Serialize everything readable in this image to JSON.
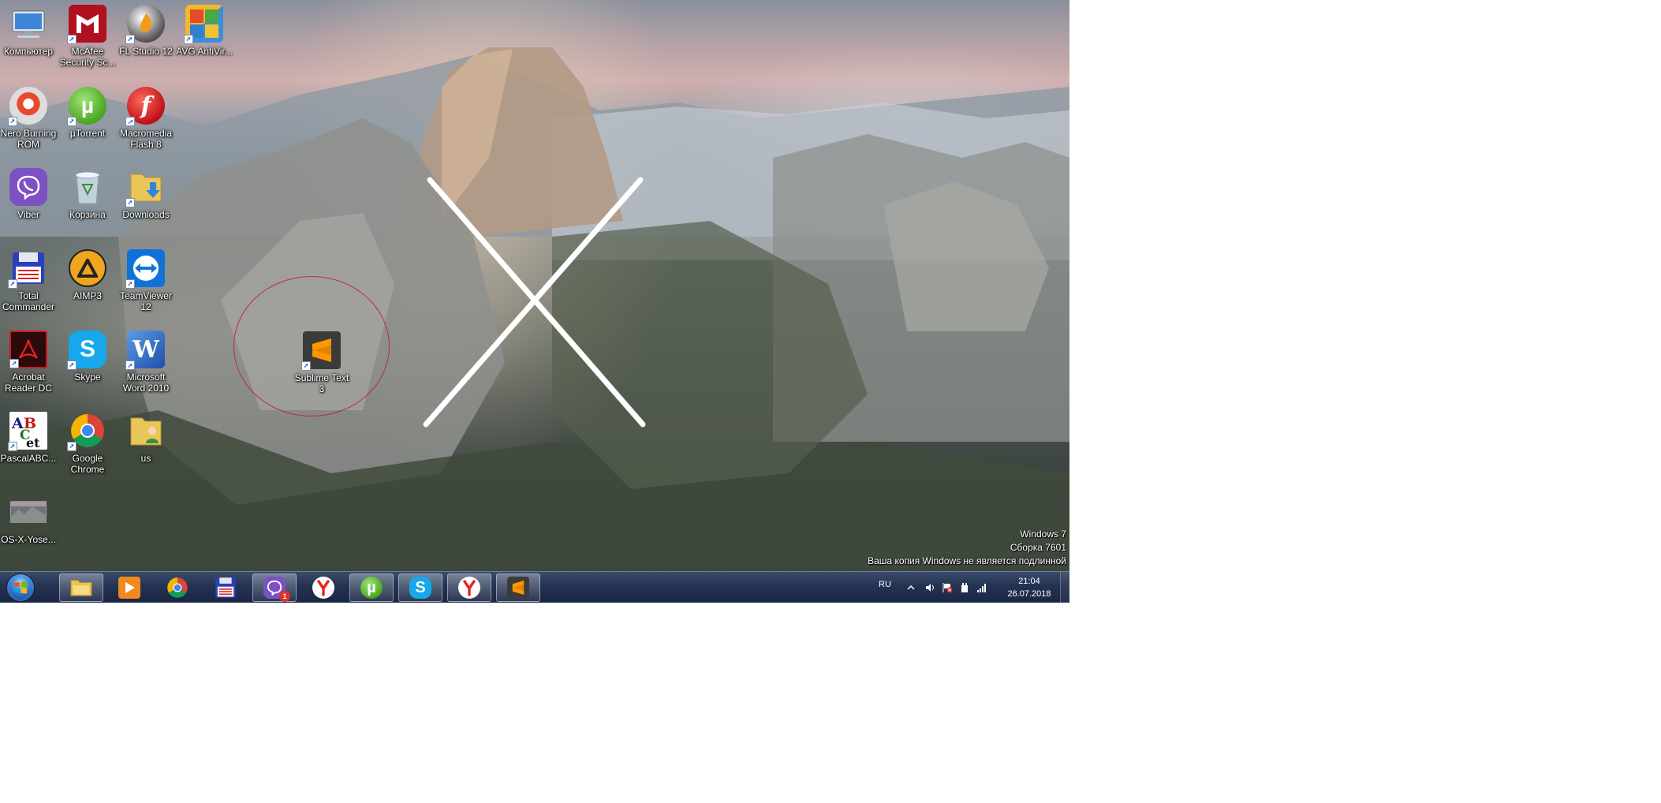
{
  "desktop": {
    "icons": [
      {
        "label": "Компьютер",
        "icon": "computer-icon"
      },
      {
        "label": "McAfee Security Sc...",
        "icon": "mcafee-icon"
      },
      {
        "label": "FL Studio 12",
        "icon": "fl-studio-icon"
      },
      {
        "label": "AVG AntiVir...",
        "icon": "avg-icon"
      },
      {
        "label": "Nero Burning ROM",
        "icon": "nero-icon"
      },
      {
        "label": "µTorrent",
        "icon": "utorrent-icon"
      },
      {
        "label": "Macromedia Flash 8",
        "icon": "flash-icon"
      },
      {
        "label": "Viber",
        "icon": "viber-icon"
      },
      {
        "label": "Корзина",
        "icon": "recycle-bin-icon"
      },
      {
        "label": "Downloads",
        "icon": "downloads-folder-icon"
      },
      {
        "label": "Total Commander",
        "icon": "total-commander-icon"
      },
      {
        "label": "AIMP3",
        "icon": "aimp-icon"
      },
      {
        "label": "TeamViewer 12",
        "icon": "teamviewer-icon"
      },
      {
        "label": "Acrobat Reader DC",
        "icon": "acrobat-icon"
      },
      {
        "label": "Skype",
        "icon": "skype-icon"
      },
      {
        "label": "Microsoft Word 2010",
        "icon": "word-icon"
      },
      {
        "label": "PascalABC...",
        "icon": "pascalabc-icon"
      },
      {
        "label": "Google Chrome",
        "icon": "chrome-icon"
      },
      {
        "label": "us",
        "icon": "user-folder-icon"
      },
      {
        "label": "OS-X-Yose...",
        "icon": "image-file-icon"
      },
      {
        "label": "Sublime Text 3",
        "icon": "sublime-text-icon"
      }
    ],
    "watermark": {
      "line1": "Windows 7",
      "line2": "Сборка 7601",
      "line3": "Ваша копия Windows не является подлинной"
    }
  },
  "taskbar": {
    "pinned": [
      {
        "name": "explorer",
        "icon": "explorer-folder-icon"
      },
      {
        "name": "media-player",
        "icon": "media-player-icon"
      },
      {
        "name": "chrome",
        "icon": "chrome-icon"
      },
      {
        "name": "total-commander",
        "icon": "total-commander-icon"
      },
      {
        "name": "viber",
        "icon": "viber-icon",
        "badge": "1"
      },
      {
        "name": "yandex",
        "icon": "yandex-browser-icon"
      },
      {
        "name": "utorrent",
        "icon": "utorrent-icon"
      },
      {
        "name": "skype",
        "icon": "skype-icon"
      },
      {
        "name": "yandex-2",
        "icon": "yandex-browser-icon"
      },
      {
        "name": "sublime-text",
        "icon": "sublime-text-icon"
      }
    ],
    "tray": {
      "language": "RU",
      "time": "21:04",
      "date": "26.07.2018"
    }
  },
  "colors": {
    "taskbar_top": "#3a4c6c",
    "taskbar_bottom": "#1a2743",
    "selection_circle": "#be1e28"
  }
}
